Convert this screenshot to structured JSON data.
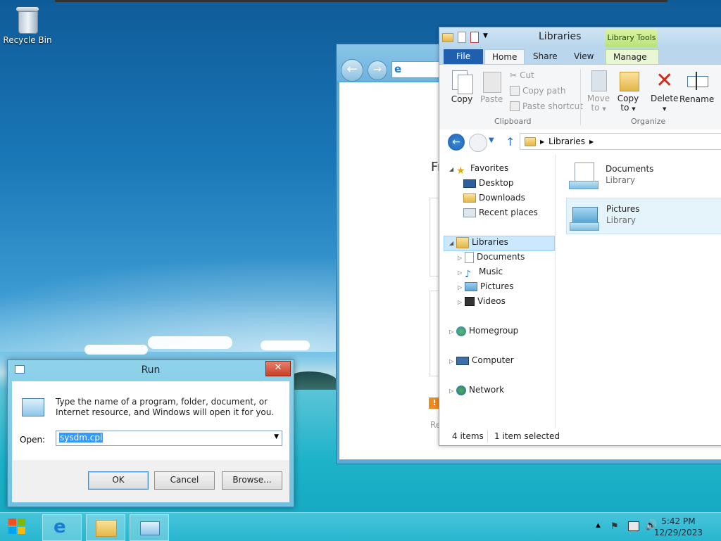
{
  "desktop": {
    "recycle_bin_label": "Recycle Bin"
  },
  "ie_window": {
    "partial_text": "Fr",
    "partial_text2": "Re",
    "orange_badge": "!"
  },
  "explorer": {
    "title": "Libraries",
    "library_tools": "Library Tools",
    "tabs": [
      "File",
      "Home",
      "Share",
      "View",
      "Manage"
    ],
    "ribbon": {
      "copy": "Copy",
      "paste": "Paste",
      "cut": "Cut",
      "copy_path": "Copy path",
      "paste_shortcut": "Paste shortcut",
      "clipboard_group": "Clipboard",
      "move_to": "Move",
      "move_to2": "to",
      "copy_to": "Copy",
      "copy_to2": "to",
      "delete": "Delete",
      "rename": "Rename",
      "organize_group": "Organize"
    },
    "address": {
      "path": "Libraries"
    },
    "nav": {
      "favorites": "Favorites",
      "desktop": "Desktop",
      "downloads": "Downloads",
      "recent_places": "Recent places",
      "libraries": "Libraries",
      "documents": "Documents",
      "music": "Music",
      "pictures": "Pictures",
      "videos": "Videos",
      "homegroup": "Homegroup",
      "computer": "Computer",
      "network": "Network"
    },
    "items": [
      {
        "name": "Documents",
        "type": "Library"
      },
      {
        "name": "Pictures",
        "type": "Library"
      }
    ],
    "status": {
      "count": "4 items",
      "selected": "1 item selected"
    }
  },
  "run_dialog": {
    "title": "Run",
    "close": "✕",
    "description": "Type the name of a program, folder, document, or Internet resource, and Windows will open it for you.",
    "open_label": "Open:",
    "open_value": "sysdm.cpl",
    "ok": "OK",
    "cancel": "Cancel",
    "browse": "Browse..."
  },
  "taskbar": {
    "time": "5:42 PM",
    "date": "12/29/2023"
  },
  "colors": {
    "accent": "#1f5fb0",
    "library_tools": "#b9e27a",
    "selection": "#cce8ff"
  }
}
